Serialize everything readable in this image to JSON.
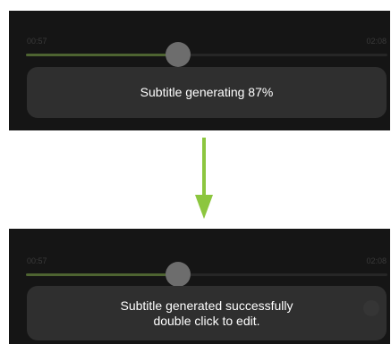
{
  "before": {
    "time_current": "00:57",
    "time_total": "02:08",
    "progress": 0.42,
    "message": "Subtitle generating 87%"
  },
  "after": {
    "time_current": "00:57",
    "time_total": "02:08",
    "progress": 0.42,
    "message_line1": "Subtitle generated successfully",
    "message_line2": "double click to edit."
  },
  "colors": {
    "arrow": "#8cc63f",
    "track_played": "#4e6431",
    "panel_bg": "#151515",
    "toast_bg": "#2f2f2f"
  },
  "icons": {
    "arrow": "arrow-down-icon"
  }
}
